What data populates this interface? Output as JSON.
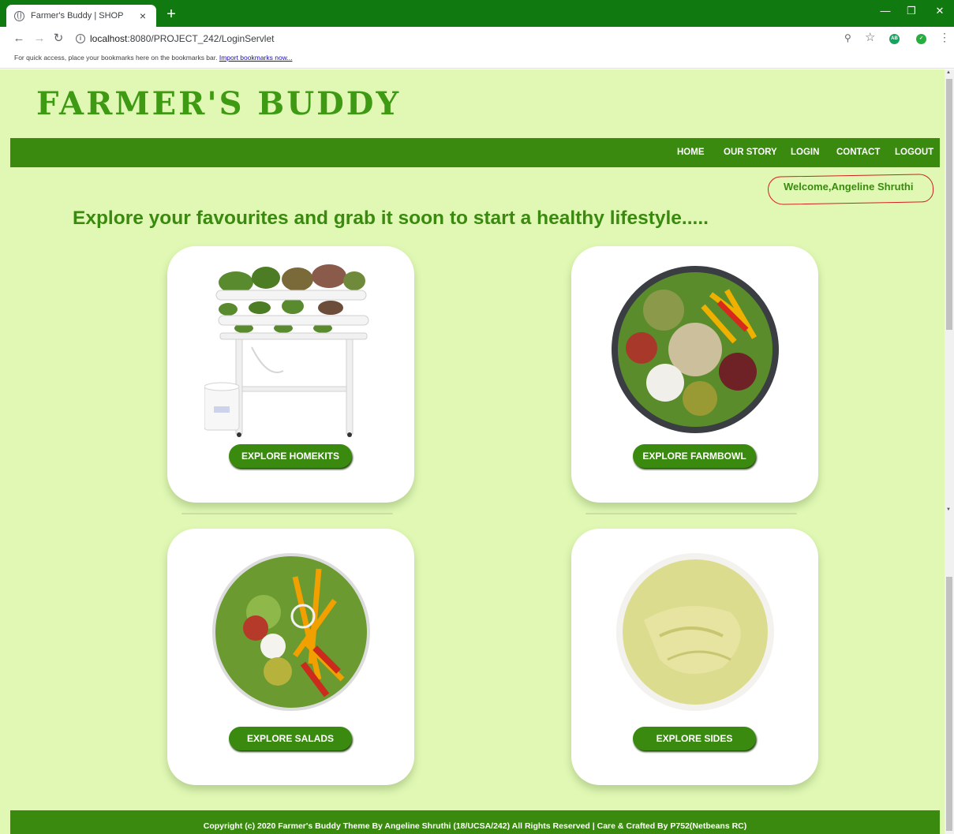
{
  "browser": {
    "tab_title": "Farmer's Buddy | SHOP",
    "tab_close": "×",
    "new_tab": "+",
    "url_host": "localhost",
    "url_rest": ":8080/PROJECT_242/LoginServlet",
    "bookmarks_text": "For quick access, place your bookmarks here on the bookmarks bar.",
    "bookmarks_link": "Import bookmarks now..."
  },
  "site": {
    "logo": "FARMER'S BUDDY",
    "nav": [
      "HOME",
      "OUR STORY",
      "LOGIN",
      "CONTACT",
      "LOGOUT"
    ],
    "welcome": "Welcome,Angeline Shruthi",
    "headline": "Explore your favourites and grab it soon to start a healthy lifestyle....."
  },
  "cards": [
    {
      "button": "EXPLORE HOMEKITS",
      "image": "hydroponic-homekit-image"
    },
    {
      "button": "EXPLORE FARMBOWL",
      "image": "farmbowl-image"
    },
    {
      "button": "EXPLORE SALADS",
      "image": "salad-image"
    },
    {
      "button": "EXPLORE SIDES",
      "image": "sides-dip-image"
    }
  ],
  "footer": "Copyright (c) 2020 Farmer's Buddy Theme By Angeline Shruthi (18/UCSA/242) All Rights Reserved | Care & Crafted By P752(Netbeans RC)",
  "colors": {
    "chrome_green": "#107a10",
    "page_bg": "#e0f8b4",
    "brand_green": "#3a8a10",
    "annotation_red": "#d21f1f"
  }
}
